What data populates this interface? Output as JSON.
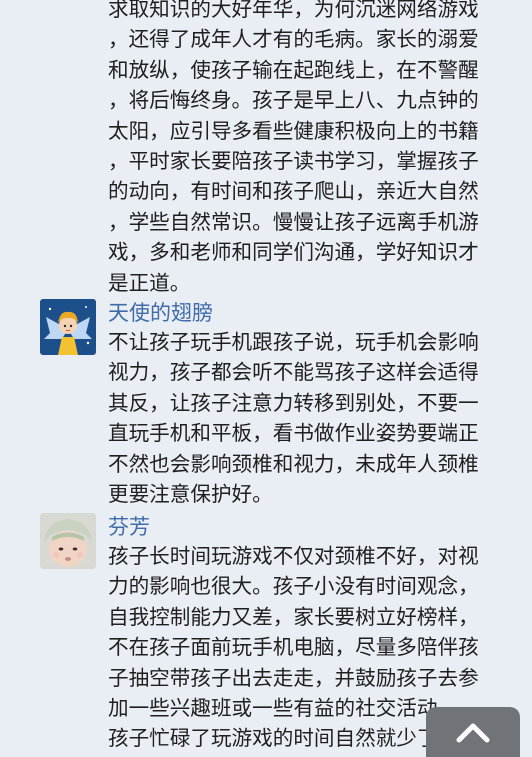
{
  "comments": [
    {
      "lines": [
        "求取知识的大好年华，为何沉迷网络游戏",
        "，还得了成年人才有的毛病。家长的溺爱",
        "和放纵，使孩子输在起跑线上，在不警醒",
        "，将后悔终身。孩子是早上八、九点钟的",
        "太阳，应引导多看些健康积极向上的书籍",
        "，平时家长要陪孩子读书学习，掌握孩子",
        "的动向，有时间和孩子爬山，亲近大自然",
        "，学些自然常识。慢慢让孩子远离手机游",
        "戏，多和老师和同学们沟通，学好知识才",
        "是正道。"
      ]
    },
    {
      "name": "天使的翅膀",
      "avatar_icon": "angel-cartoon-avatar",
      "lines": [
        "不让孩子玩手机跟孩子说，玩手机会影响",
        "视力，孩子都会听不能骂孩子这样会适得",
        "其反，让孩子注意力转移到别处，不要一",
        "直玩手机和平板，看书做作业姿势要端正",
        "不然也会影响颈椎和视力，未成年人颈椎",
        "更要注意保护好。"
      ]
    },
    {
      "name": "芬芳",
      "avatar_icon": "baby-photo-avatar",
      "lines": [
        "孩子长时间玩游戏不仅对颈椎不好，对视",
        "力的影响也很大。孩子小没有时间观念，",
        "自我控制能力又差，家长要树立好榜样，",
        "不在孩子面前玩手机电脑，尽量多陪伴孩",
        "子抽空带孩子出去走走，并鼓励孩子去参",
        "加一些兴趣班或一些有益的社交活动，",
        "孩子忙碌了玩游戏的时间自然就少了。"
      ]
    }
  ],
  "scroll_top": {
    "icon": "chevron-up-icon"
  },
  "colors": {
    "background": "#e9eef5",
    "username": "#3f6ca8",
    "text": "#1f1f1f",
    "scroll_button": "#707377"
  }
}
